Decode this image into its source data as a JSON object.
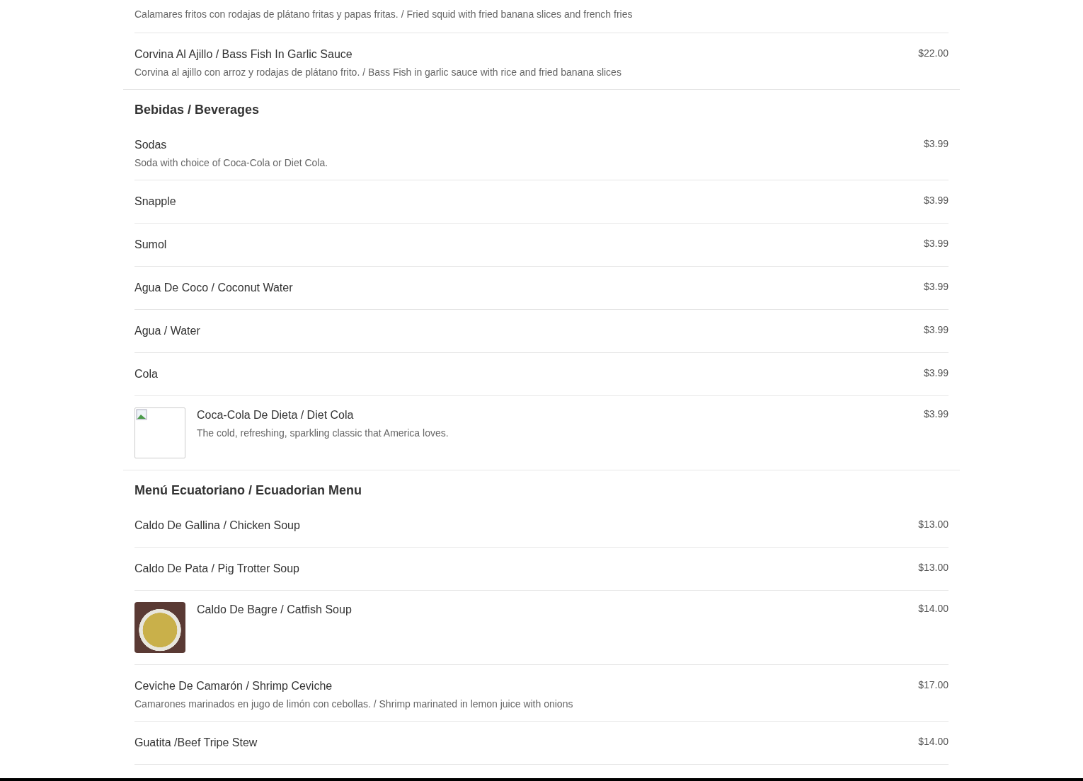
{
  "sections": [
    {
      "items": [
        {
          "description": "Calamares fritos con rodajas de plátano fritas y papas fritas. / Fried squid with fried banana slices and french fries"
        },
        {
          "name": "Corvina Al Ajillo / Bass Fish In Garlic Sauce",
          "description": "Corvina al ajillo con arroz y rodajas de plátano frito. / Bass Fish in garlic sauce with rice and fried banana slices",
          "price": "$22.00"
        }
      ]
    },
    {
      "title": "Bebidas / Beverages",
      "items": [
        {
          "name": "Sodas",
          "description": "Soda with choice of Coca-Cola or Diet Cola.",
          "price": "$3.99"
        },
        {
          "name": "Snapple",
          "price": "$3.99"
        },
        {
          "name": "Sumol",
          "price": "$3.99"
        },
        {
          "name": "Agua De Coco / Coconut Water",
          "price": "$3.99"
        },
        {
          "name": "Agua / Water",
          "price": "$3.99"
        },
        {
          "name": "Cola",
          "price": "$3.99"
        },
        {
          "name": "Coca-Cola De Dieta / Diet Cola",
          "description": "The cold, refreshing, sparkling classic that America loves.",
          "price": "$3.99",
          "kind": "broken-image"
        }
      ]
    },
    {
      "title": "Menú Ecuatoriano / Ecuadorian Menu",
      "items": [
        {
          "name": "Caldo De Gallina / Chicken Soup",
          "price": "$13.00"
        },
        {
          "name": "Caldo De Pata / Pig Trotter Soup",
          "price": "$13.00"
        },
        {
          "name": "Caldo De Bagre / Catfish Soup",
          "price": "$14.00",
          "kind": "photo"
        },
        {
          "name": "Ceviche De Camarón / Shrimp Ceviche",
          "description": "Camarones marinados en jugo de limón con cebollas. / Shrimp marinated in lemon juice with onions",
          "price": "$17.00"
        },
        {
          "name": "Guatita /Beef Tripe Stew",
          "price": "$14.00"
        }
      ]
    }
  ]
}
